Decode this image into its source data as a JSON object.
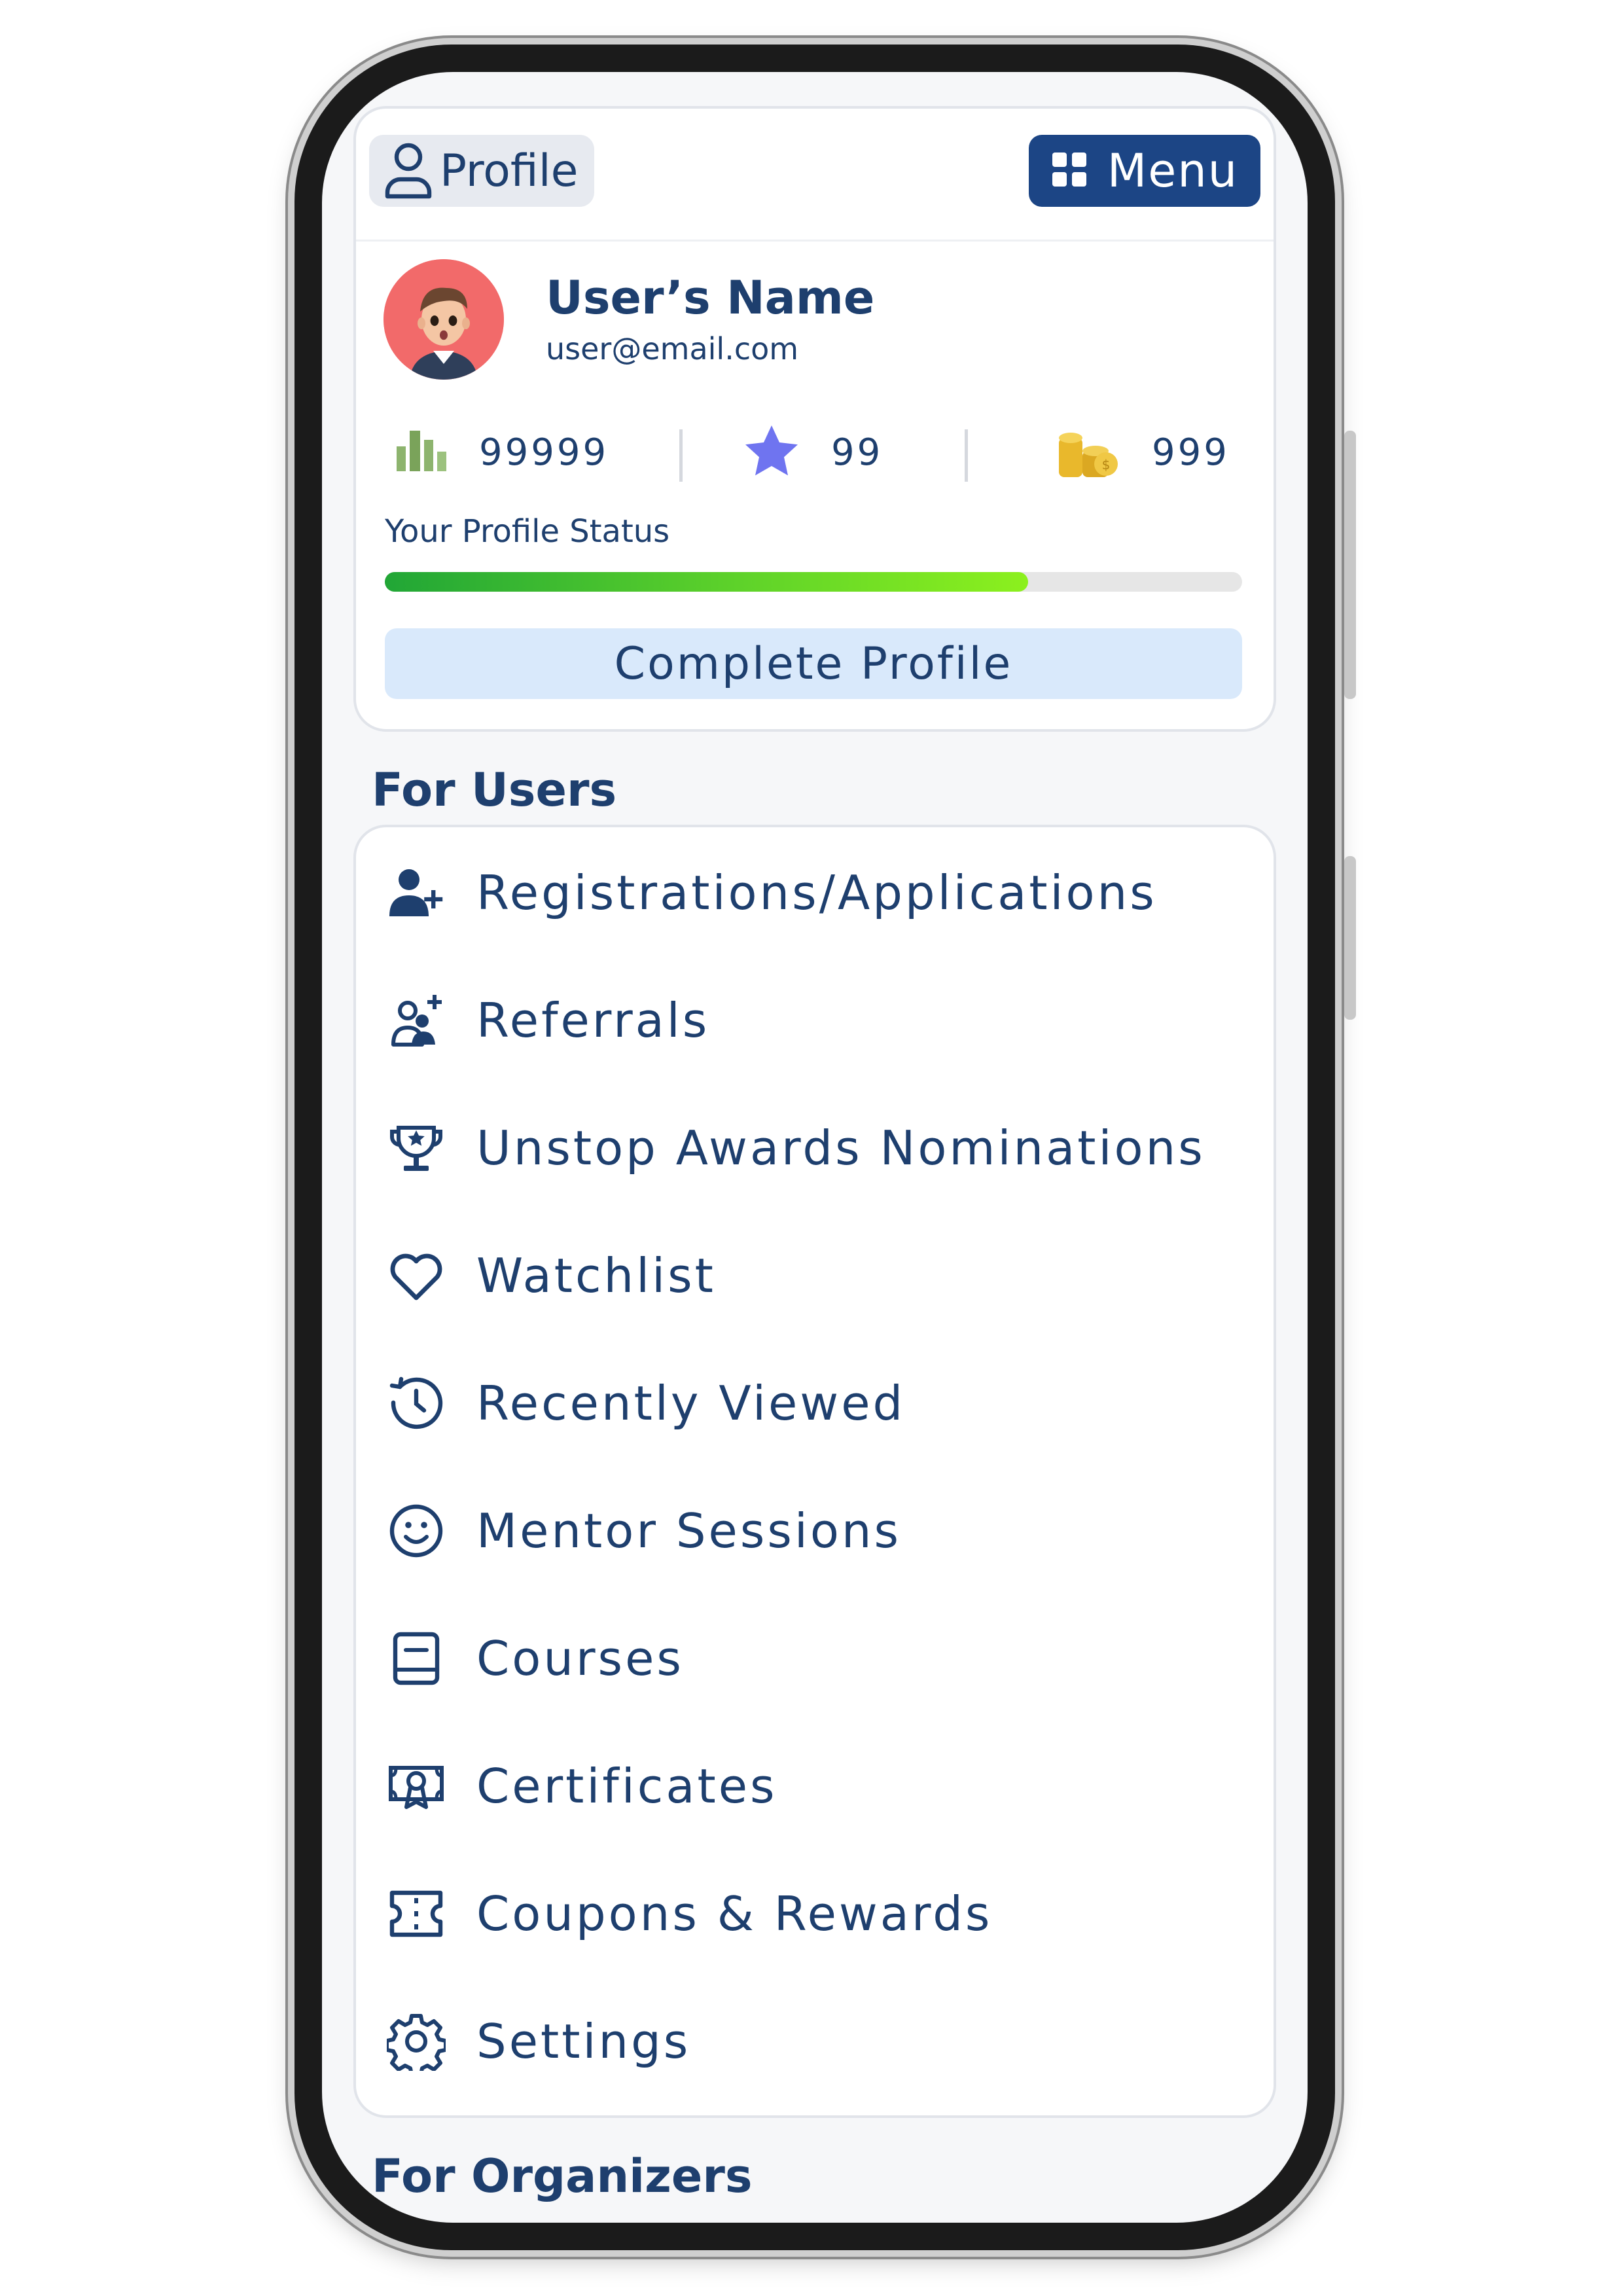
{
  "header": {
    "profile_label": "Profile",
    "menu_label": "Menu"
  },
  "user": {
    "name": "User’s Name",
    "email": "user@email.com"
  },
  "stats": {
    "rank_value": "99999",
    "stars_value": "99",
    "coins_value": "999"
  },
  "profile_status": {
    "label": "Your Profile Status",
    "progress_percent": 75,
    "complete_button": "Complete Profile"
  },
  "sections": {
    "for_users": "For Users",
    "for_organizers": "For Organizers"
  },
  "menu_items": [
    {
      "label": "Registrations/Applications",
      "icon": "user-add-icon"
    },
    {
      "label": "Referrals",
      "icon": "referral-icon"
    },
    {
      "label": "Unstop Awards Nominations",
      "icon": "trophy-star-icon"
    },
    {
      "label": "Watchlist",
      "icon": "heart-icon"
    },
    {
      "label": "Recently Viewed",
      "icon": "history-clock-icon"
    },
    {
      "label": "Mentor Sessions",
      "icon": "smiley-icon"
    },
    {
      "label": "Courses",
      "icon": "book-icon"
    },
    {
      "label": "Certificates",
      "icon": "certificate-icon"
    },
    {
      "label": "Coupons & Rewards",
      "icon": "coupon-icon"
    },
    {
      "label": "Settings",
      "icon": "gear-icon"
    }
  ],
  "colors": {
    "primary": "#1c4585",
    "text": "#1e3f6e",
    "progress_start": "#21a636",
    "progress_end": "#8cf01e",
    "avatar_bg": "#f26a6a",
    "button_light": "#d9e9fb"
  }
}
